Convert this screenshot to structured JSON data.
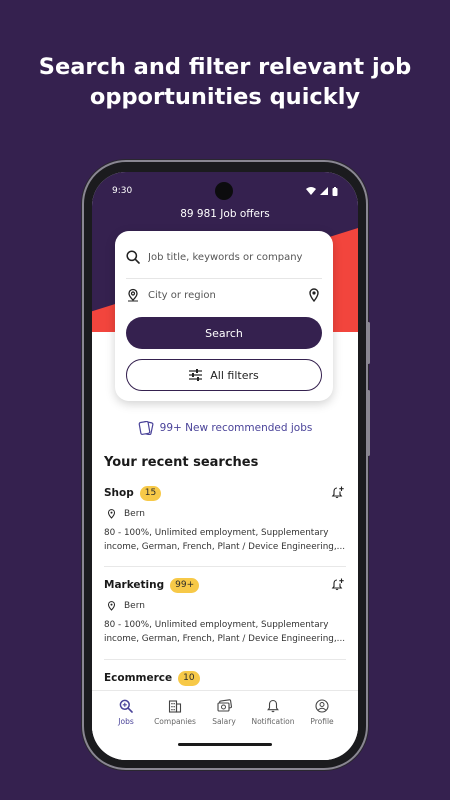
{
  "headline": {
    "line1": "Search and filter relevant job",
    "line2": "opportunities quickly"
  },
  "status_bar": {
    "time": "9:30"
  },
  "header": {
    "offers": "89 981 Job offers"
  },
  "search": {
    "keywords_placeholder": "Job title, keywords or company",
    "location_placeholder": "City or region",
    "search_label": "Search",
    "filters_label": "All filters"
  },
  "recommended": {
    "label": "99+ New recommended jobs"
  },
  "recent": {
    "title": "Your recent searches",
    "items": [
      {
        "title": "Shop",
        "badge": "15",
        "location": "Bern",
        "desc_line1": "80 - 100%, Unlimited employment, Supplementary",
        "desc_line2": "income, German, French, Plant / Device Engineering,..."
      },
      {
        "title": "Marketing",
        "badge": "99+",
        "location": "Bern",
        "desc_line1": "80 - 100%, Unlimited employment, Supplementary",
        "desc_line2": "income, German, French, Plant / Device Engineering,..."
      },
      {
        "title": "Ecommerce",
        "badge": "10"
      }
    ]
  },
  "nav": {
    "items": [
      {
        "label": "Jobs",
        "icon": "search-icon",
        "active": true
      },
      {
        "label": "Companies",
        "icon": "building-icon"
      },
      {
        "label": "Salary",
        "icon": "money-icon"
      },
      {
        "label": "Notification",
        "icon": "bell-icon"
      },
      {
        "label": "Profile",
        "icon": "profile-icon"
      }
    ]
  },
  "colors": {
    "brand": "#35214f",
    "accent_red": "#f2453d",
    "badge": "#f7c948",
    "link": "#4a4399"
  }
}
